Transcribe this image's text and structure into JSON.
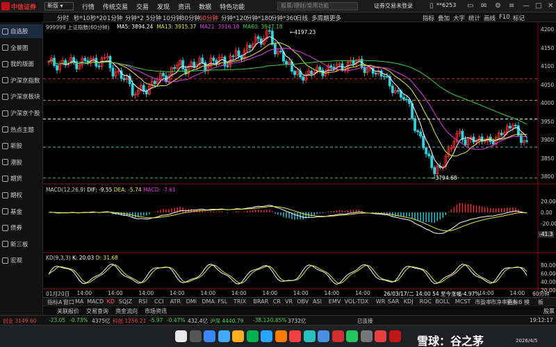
{
  "app": {
    "logo_text": "中信证券",
    "version": "新版",
    "menu": [
      "行情",
      "传统交易",
      "交易",
      "发现",
      "资讯",
      "数据",
      "特色功能"
    ],
    "search_placeholder": "股票/理财/常用功能",
    "login": "证券交易未登录",
    "account": "**6253"
  },
  "sidebar": [
    {
      "label": "自选股",
      "active": true
    },
    {
      "label": "全景图"
    },
    {
      "label": "我的版面"
    },
    {
      "label": "沪深京指数"
    },
    {
      "label": "沪深京板块"
    },
    {
      "label": "沪深京个股"
    },
    {
      "label": "热点主题"
    },
    {
      "label": "新股"
    },
    {
      "label": "港股"
    },
    {
      "label": "期货"
    },
    {
      "label": "期权"
    },
    {
      "label": "基金"
    },
    {
      "label": "债券"
    },
    {
      "label": "新三板"
    },
    {
      "label": "宏观"
    }
  ],
  "toolbar": {
    "timeframes": [
      "分时",
      "秒*10",
      "秒*20",
      "1分钟",
      "分钟*2",
      "5分钟",
      "10分钟",
      "30分钟",
      "60分钟",
      "分钟*120",
      "分钟*180",
      "分钟*360",
      "日线",
      "多周期",
      "更多"
    ],
    "active_timeframe": "60分钟",
    "right_items": [
      "指标",
      "叠加",
      "大字",
      "统计",
      "画线",
      "F10",
      "标记"
    ]
  },
  "main_chart": {
    "symbol_title": "999999 上证指数(60分钟)",
    "ma": [
      {
        "label": "MA5: 3894.24",
        "color": "#ffffff"
      },
      {
        "label": "MA13: 3915.37",
        "color": "#e8e840"
      },
      {
        "label": "MA21: 3916.18",
        "color": "#e040e0"
      },
      {
        "label": "MA60: 3947.18",
        "color": "#40d040"
      }
    ],
    "y_ticks": [
      "4200",
      "4150",
      "4100",
      "4050",
      "4000",
      "3950",
      "3900",
      "3850",
      "3800"
    ],
    "high_label": "4197.23",
    "low_label": "3794.68"
  },
  "macd": {
    "title": "MACD(12,26,9)",
    "dif": "DIF: -9.55",
    "dea": "DEA: -5.74",
    "macd": "MACD: -7.61",
    "y_ticks": [
      "20.00",
      "0.00",
      "-20.00"
    ],
    "current": "-41.3"
  },
  "kd": {
    "title": "KD(9,3,3)",
    "k": "K: 20.03",
    "d": "D: 31.68",
    "y_ticks": [
      "80.00",
      "60.00",
      "40.00",
      "20.00"
    ]
  },
  "x_axis": {
    "labels": [
      "01月20日",
      "14:00",
      "14:00",
      "14:00",
      "14:00",
      "14:00",
      "14:00",
      "14:00",
      "14:00",
      "14:00",
      "14:00",
      "14:00",
      "14:00",
      "14:00",
      "14:00",
      "14:00"
    ],
    "crosshair_label": "26/03/17/二 14:00 54 至今涨幅-4.97%",
    "right_label": "60分钟"
  },
  "indicator_tabs": [
    "指标A",
    "窗口",
    "MA",
    "MACD",
    "KD",
    "SQJZ",
    "RSI",
    "CCI",
    "ATR",
    "DMI",
    "DMA",
    "FSL",
    "TRIX",
    "BRAR",
    "CR",
    "VR",
    "OBV",
    "ASI",
    "EMV",
    "VOL-TDX",
    "WR",
    "SAR",
    "KDJ",
    "ROC",
    "BOLL",
    "MCST",
    "市盈率",
    "市净率",
    "更多"
  ],
  "indicator_active": "KD",
  "right_tabs": [
    "指标B",
    "模",
    "板"
  ],
  "sub_tabs": [
    "关联报价",
    "交易查询",
    "资金流向",
    "市场资讯"
  ],
  "right_sub": "股票查询",
  "status": [
    {
      "text": "创业 3149.60",
      "color": "#e84040"
    },
    {
      "text": "-23.05",
      "color": "#40d040"
    },
    {
      "text": "-0.73%",
      "color": "#40d040"
    },
    {
      "text": "4375亿",
      "color": "#ccc"
    },
    {
      "text": "科创 1256.21",
      "color": "#e84040"
    },
    {
      "text": "-5.97",
      "color": "#40d040"
    },
    {
      "text": "-0.47%",
      "color": "#40d040"
    },
    {
      "text": "432.4亿",
      "color": "#ccc"
    },
    {
      "text": "沪深 4440.79",
      "color": "#40d040"
    },
    {
      "text": "-38.12",
      "color": "#40d040"
    },
    {
      "text": "-0.85%",
      "color": "#40d040"
    },
    {
      "text": "3732亿",
      "color": "#ccc"
    },
    {
      "text": "已连接",
      "color": "#ccc"
    }
  ],
  "clock": "19:12:17",
  "watermark": "雪球：谷之茅",
  "watermark_date": "2026/4/5"
}
